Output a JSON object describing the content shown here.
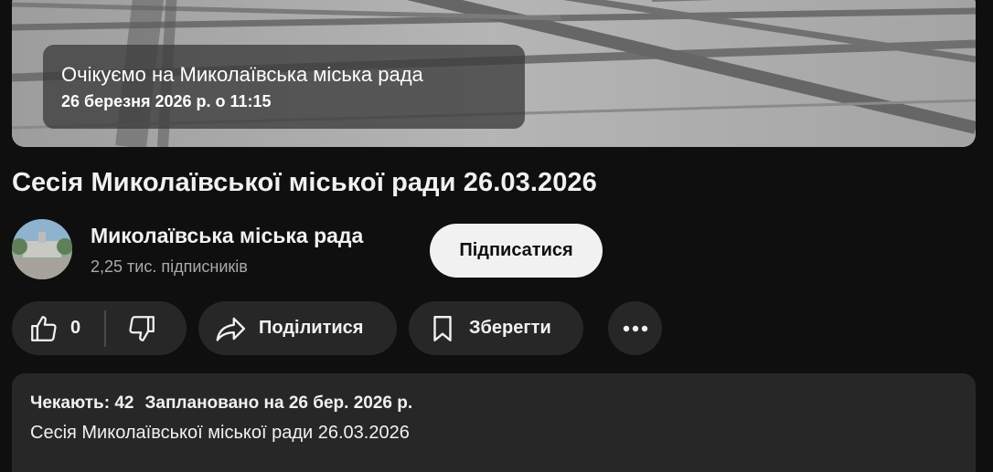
{
  "player": {
    "waiting_title": "Очікуємо на Миколаївська міська рада",
    "waiting_date": "26 березня 2026 р. о 11:15"
  },
  "video": {
    "title": "Сесія Миколаївської міської ради 26.03.2026"
  },
  "channel": {
    "name": "Миколаївська міська рада",
    "subscribers": "2,25 тис. підписників",
    "subscribe_label": "Підписатися",
    "avatar_icon": "channel-avatar-city-hall"
  },
  "actions": {
    "like_count": "0",
    "like_icon": "thumbs-up-icon",
    "dislike_icon": "thumbs-down-icon",
    "share_label": "Поділитися",
    "share_icon": "share-arrow-icon",
    "save_label": "Зберегти",
    "save_icon": "bookmark-icon",
    "more_icon": "more-horizontal-icon"
  },
  "description": {
    "waiting": "Чекають: 42",
    "scheduled": "Заплановано на 26 бер. 2026 р.",
    "text": "Сесія Миколаївської міської ради 26.03.2026"
  },
  "colors": {
    "background": "#0f0f0f",
    "surface": "#272727",
    "text": "#f1f1f1",
    "secondary_text": "#aaaaaa",
    "subscribe_bg": "#f1f1f1"
  }
}
